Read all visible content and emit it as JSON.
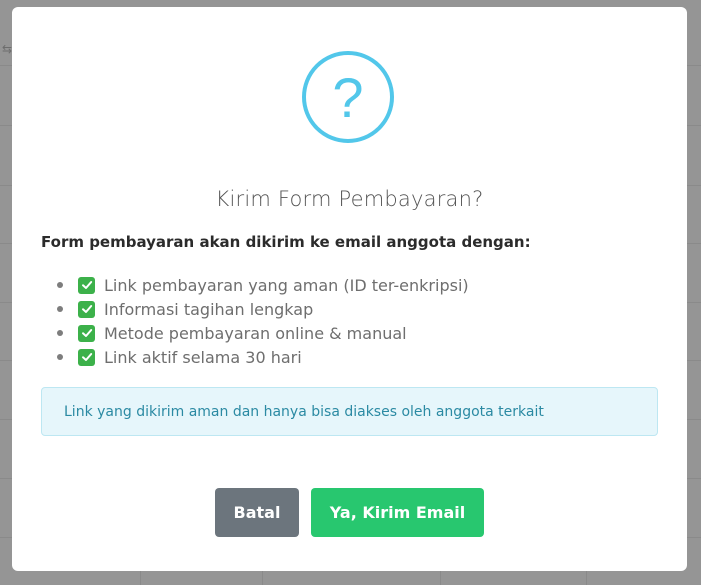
{
  "dialog": {
    "title": "Kirim Form Pembayaran?",
    "icon": "question-icon",
    "icon_glyph": "?",
    "lead": "Form pembayaran akan dikirim ke email anggota dengan:",
    "features": [
      "Link pembayaran yang aman (ID ter-enkripsi)",
      "Informasi tagihan lengkap",
      "Metode pembayaran online & manual",
      "Link aktif selama 30 hari"
    ],
    "info_text": "Link yang dikirim aman dan hanya bisa diakses oleh anggota terkait",
    "cancel_label": "Batal",
    "confirm_label": "Ya, Kirim Email"
  },
  "colors": {
    "icon_accent": "#52c7ea",
    "cancel_button": "#6c757d",
    "confirm_button": "#28c76f",
    "checkbox": "#3cb14a",
    "info_text": "#2b8aa3",
    "info_bg": "#e6f6fb"
  }
}
